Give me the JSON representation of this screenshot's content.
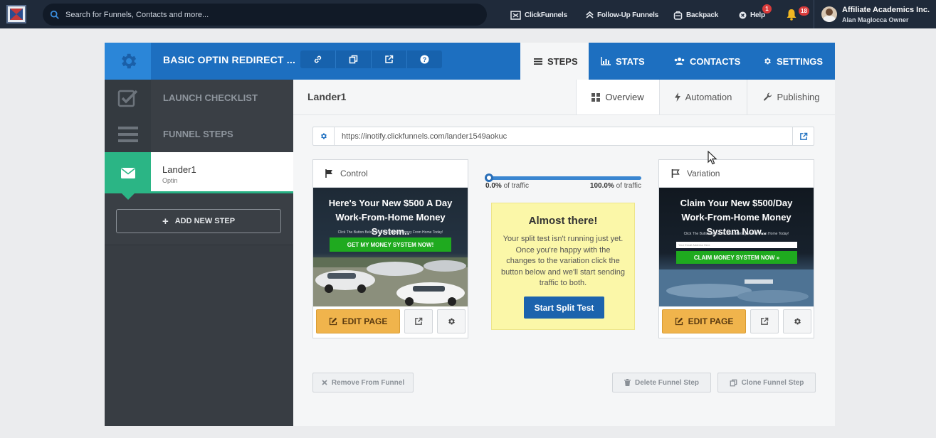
{
  "topnav": {
    "search_placeholder": "Search for Funnels, Contacts and more...",
    "links": {
      "clickfunnels": "ClickFunnels",
      "followup": "Follow-Up Funnels",
      "backpack": "Backpack",
      "help": "Help"
    },
    "help_badge": "1",
    "notifications_badge": "18",
    "user_name": "Affiliate Academics Inc.",
    "user_role": "Alan Maglocca   Owner"
  },
  "header": {
    "funnel_title": "BASIC OPTIN REDIRECT ...",
    "tabs": {
      "steps": "STEPS",
      "stats": "STATS",
      "contacts": "CONTACTS",
      "settings": "SETTINGS"
    }
  },
  "sidebar": {
    "launch_checklist": "LAUNCH CHECKLIST",
    "funnel_steps": "FUNNEL STEPS",
    "step_name": "Lander1",
    "step_type": "Optin",
    "add_step": "ADD NEW STEP"
  },
  "content": {
    "title": "Lander1",
    "subtabs": {
      "overview": "Overview",
      "automation": "Automation",
      "publishing": "Publishing"
    },
    "url": "https://inotify.clickfunnels.com/lander1549aokuc"
  },
  "control": {
    "label": "Control",
    "thumb_headline": "Here's Your New $500 A Day Work-From-Home Money System..",
    "thumb_sub": "Click The Button Below To Start Making Money From Home Today!",
    "thumb_cta": "GET MY MONEY SYSTEM NOW!",
    "edit_label": "EDIT PAGE"
  },
  "variation": {
    "label": "Variation",
    "thumb_headline": "Claim Your New $500/Day Work-From-Home Money System Now..",
    "thumb_sub": "Click The Button Below To Start Making Money From Home Today!",
    "thumb_input": "Your Email Address Here",
    "thumb_cta": "CLAIM MONEY SYSTEM NOW »",
    "edit_label": "EDIT PAGE"
  },
  "traffic": {
    "left_value": "0.0%",
    "right_value": "100.0%",
    "suffix": " of traffic",
    "position_fraction": 0
  },
  "notice": {
    "title": "Almost there!",
    "body": "Your split test isn't running just yet. Once you're happy with the changes to the variation click the button below and we'll start sending traffic to both.",
    "button": "Start Split Test"
  },
  "footer": {
    "remove": "Remove From Funnel",
    "delete": "Delete Funnel Step",
    "clone": "Clone Funnel Step"
  },
  "colors": {
    "header_blue": "#1d6fc0",
    "step_green": "#2bb585",
    "edit_orange": "#f0b44c",
    "notice_yellow": "#fbf7a8"
  }
}
